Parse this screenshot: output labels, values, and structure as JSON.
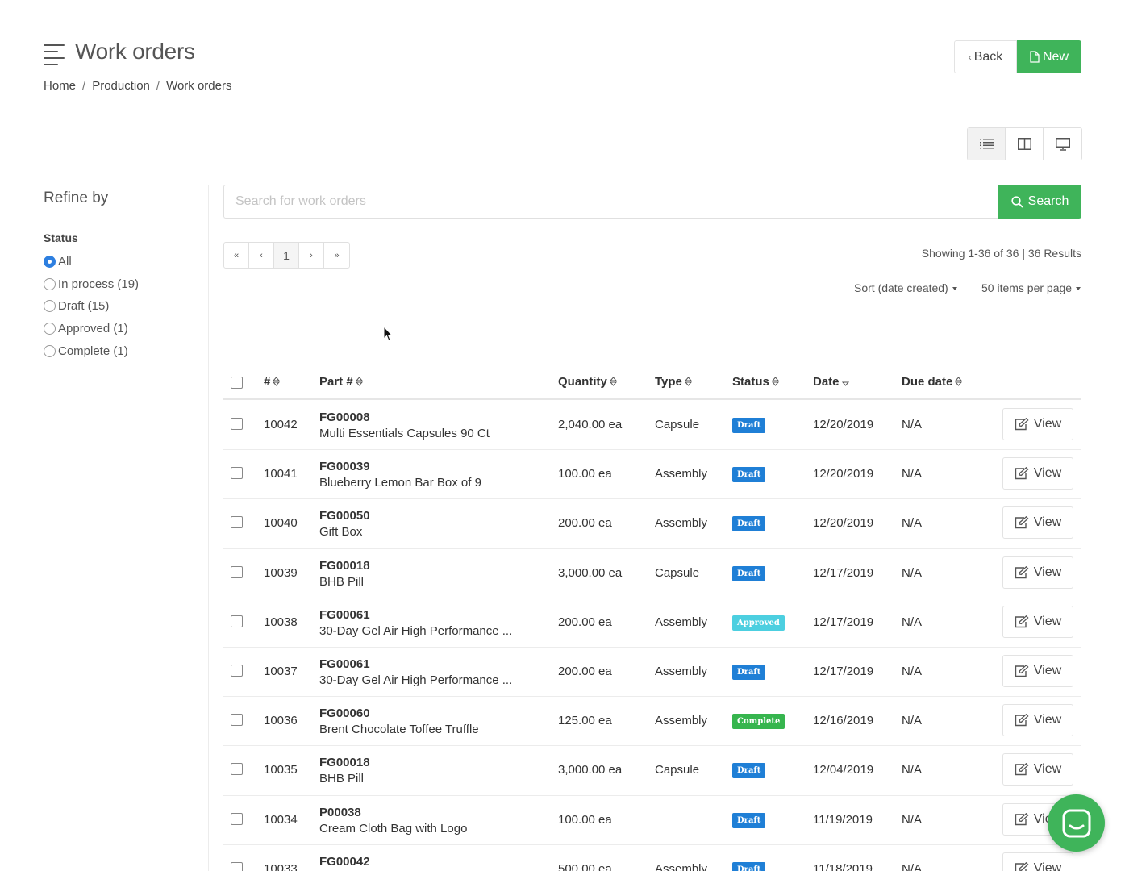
{
  "header": {
    "title": "Work orders",
    "back_label": "Back",
    "new_label": "New"
  },
  "breadcrumb": [
    "Home",
    "Production",
    "Work orders"
  ],
  "sidebar": {
    "title": "Refine by",
    "status_label": "Status",
    "options": [
      {
        "label": "All",
        "checked": true
      },
      {
        "label": "In process (19)",
        "checked": false
      },
      {
        "label": "Draft (15)",
        "checked": false
      },
      {
        "label": "Approved (1)",
        "checked": false
      },
      {
        "label": "Complete (1)",
        "checked": false
      }
    ]
  },
  "search": {
    "placeholder": "Search for work orders",
    "button_label": "Search"
  },
  "pagination": {
    "first": "«",
    "prev": "‹",
    "current": "1",
    "next": "›",
    "last": "»"
  },
  "results_text": "Showing 1-36 of 36 | 36 Results",
  "sort_label": "Sort (date created)",
  "per_page_label": "50 items per page",
  "table": {
    "headers": {
      "id": "#",
      "part": "Part #",
      "quantity": "Quantity",
      "type": "Type",
      "status": "Status",
      "date": "Date",
      "due": "Due date"
    },
    "view_label": "View",
    "rows": [
      {
        "id": "10042",
        "part_no": "FG00008",
        "part_name": "Multi Essentials Capsules 90 Ct",
        "qty": "2,040.00 ea",
        "type": "Capsule",
        "status": "Draft",
        "date": "12/20/2019",
        "due": "N/A"
      },
      {
        "id": "10041",
        "part_no": "FG00039",
        "part_name": "Blueberry Lemon Bar Box of 9",
        "qty": "100.00 ea",
        "type": "Assembly",
        "status": "Draft",
        "date": "12/20/2019",
        "due": "N/A"
      },
      {
        "id": "10040",
        "part_no": "FG00050",
        "part_name": "Gift Box",
        "qty": "200.00 ea",
        "type": "Assembly",
        "status": "Draft",
        "date": "12/20/2019",
        "due": "N/A"
      },
      {
        "id": "10039",
        "part_no": "FG00018",
        "part_name": "BHB Pill",
        "qty": "3,000.00 ea",
        "type": "Capsule",
        "status": "Draft",
        "date": "12/17/2019",
        "due": "N/A"
      },
      {
        "id": "10038",
        "part_no": "FG00061",
        "part_name": "30-Day Gel Air High Performance ...",
        "qty": "200.00 ea",
        "type": "Assembly",
        "status": "Approved",
        "date": "12/17/2019",
        "due": "N/A"
      },
      {
        "id": "10037",
        "part_no": "FG00061",
        "part_name": "30-Day Gel Air High Performance ...",
        "qty": "200.00 ea",
        "type": "Assembly",
        "status": "Draft",
        "date": "12/17/2019",
        "due": "N/A"
      },
      {
        "id": "10036",
        "part_no": "FG00060",
        "part_name": "Brent Chocolate Toffee Truffle",
        "qty": "125.00 ea",
        "type": "Assembly",
        "status": "Complete",
        "date": "12/16/2019",
        "due": "N/A"
      },
      {
        "id": "10035",
        "part_no": "FG00018",
        "part_name": "BHB Pill",
        "qty": "3,000.00 ea",
        "type": "Capsule",
        "status": "Draft",
        "date": "12/04/2019",
        "due": "N/A"
      },
      {
        "id": "10034",
        "part_no": "P00038",
        "part_name": "Cream Cloth Bag with Logo",
        "qty": "100.00 ea",
        "type": "",
        "status": "Draft",
        "date": "11/19/2019",
        "due": "N/A"
      },
      {
        "id": "10033",
        "part_no": "FG00042",
        "part_name": "",
        "qty": "500.00 ea",
        "type": "Assembly",
        "status": "Draft",
        "date": "11/18/2019",
        "due": "N/A"
      }
    ]
  },
  "status_colors": {
    "Draft": "#1f7fd6",
    "Approved": "#4ccfe0",
    "Complete": "#36b54e"
  },
  "colors": {
    "accent_green": "#3fb45a",
    "radio_blue": "#2d7fe0"
  },
  "icons": {
    "menu": "hamburger-icon",
    "back": "chevron-left-icon",
    "new": "document-icon",
    "search": "magnifier-icon",
    "list_view": "list-icon",
    "split_view": "columns-icon",
    "monitor_view": "monitor-icon",
    "view": "edit-icon",
    "chat": "chat-icon"
  }
}
